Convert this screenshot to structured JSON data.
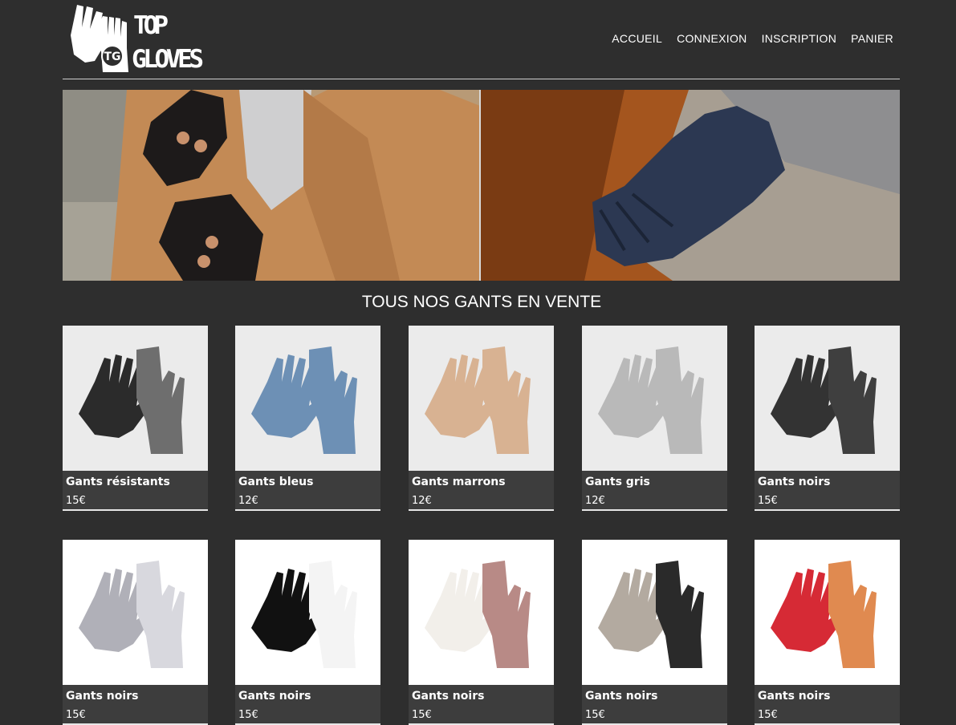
{
  "brand": {
    "logo_line1": "TOP",
    "logo_line2": "GLOVES",
    "logo_mark": "TG"
  },
  "nav": [
    {
      "label": "ACCUEIL"
    },
    {
      "label": "CONNEXION"
    },
    {
      "label": "INSCRIPTION"
    },
    {
      "label": "PANIER"
    }
  ],
  "section_title": "TOUS NOS GANTS EN VENTE",
  "products": [
    {
      "name": "Gants résistants",
      "price": "15€",
      "color": "#2b2b2b",
      "color2": "#6e6e6e"
    },
    {
      "name": "Gants bleus",
      "price": "12€",
      "color": "#6d90b5",
      "color2": "#6d90b5"
    },
    {
      "name": "Gants marrons",
      "price": "12€",
      "color": "#d8b292",
      "color2": "#d8b292"
    },
    {
      "name": "Gants gris",
      "price": "12€",
      "color": "#b9b9b9",
      "color2": "#b9b9b9"
    },
    {
      "name": "Gants noirs",
      "price": "15€",
      "color": "#333333",
      "color2": "#3f3f3f"
    },
    {
      "name": "Gants noirs",
      "price": "15€",
      "color": "#b0b0b8",
      "color2": "#d8d8de"
    },
    {
      "name": "Gants noirs",
      "price": "15€",
      "color": "#111111",
      "color2": "#f4f4f4"
    },
    {
      "name": "Gants noirs",
      "price": "15€",
      "color": "#f2efea",
      "color2": "#b88a86"
    },
    {
      "name": "Gants noirs",
      "price": "15€",
      "color": "#b3aaa0",
      "color2": "#2a2a2a"
    },
    {
      "name": "Gants noirs",
      "price": "15€",
      "color": "#d62a35",
      "color2": "#e08a50"
    }
  ]
}
